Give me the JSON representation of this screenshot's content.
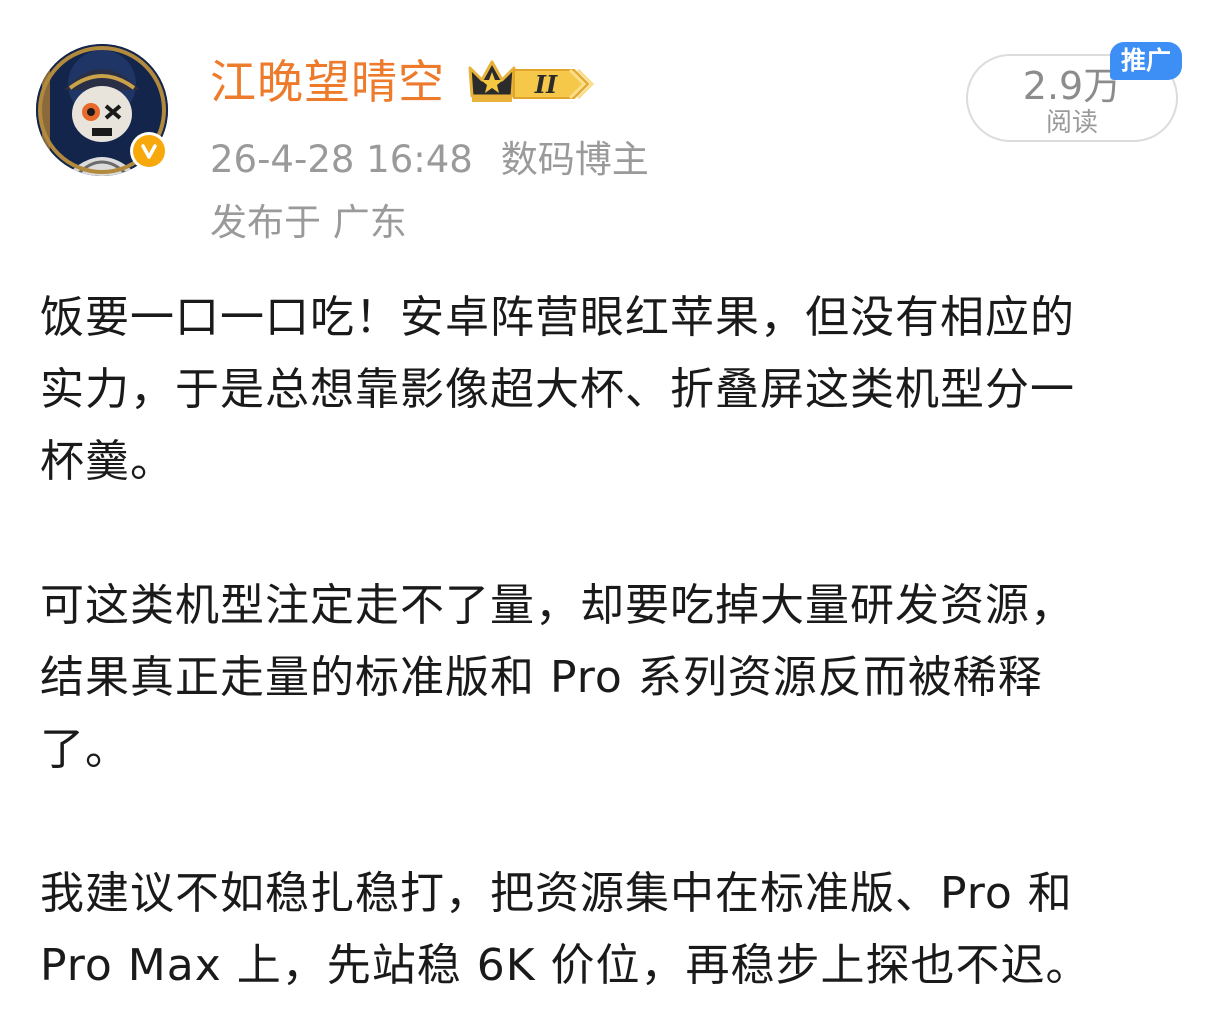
{
  "post": {
    "author": {
      "name": "江晚望晴空",
      "rank_badge_text": "II",
      "verified_color": "#f7a80b"
    },
    "meta": {
      "timestamp": "26-4-28 16:48",
      "tag": "数码博主",
      "location": "发布于 广东"
    },
    "stats": {
      "read_count": "2.9万",
      "read_label": "阅读",
      "promo_label": "推广"
    },
    "paragraphs": [
      {
        "lines": [
          "饭要一口一口吃！安卓阵营眼红苹果，但没有相应的",
          "实力，于是总想靠影像超大杯、折叠屏这类机型分一",
          "杯羹。"
        ]
      },
      {
        "lines": [
          "可这类机型注定走不了量，却要吃掉大量研发资源，",
          "结果真正走量的标准版和 Pro 系列资源反而被稀释",
          "了。"
        ]
      },
      {
        "lines": [
          "我建议不如稳扎稳打，把资源集中在标准版、Pro 和",
          "Pro Max 上，先站稳 6K 价位，再稳步上探也不迟。"
        ]
      }
    ]
  },
  "colors": {
    "name": "#ee7b2c",
    "meta": "#9a9a9a",
    "body": "#1a1a1a",
    "promo": "#3d8ff6"
  }
}
